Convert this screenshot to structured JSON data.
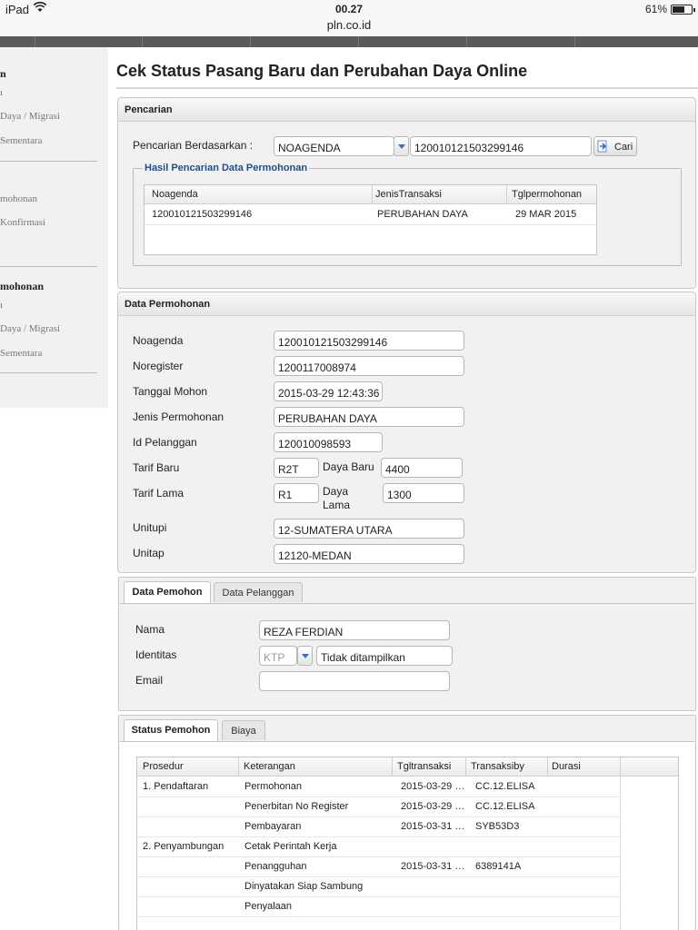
{
  "status_bar": {
    "device": "iPad",
    "time": "00.27",
    "url": "pln.co.id",
    "battery": "61%"
  },
  "sidebar": {
    "items": [
      {
        "text": "n",
        "bold": true
      },
      {
        "text": "ı",
        "bold": false
      },
      {
        "text": "Daya / Migrasi",
        "bold": false
      },
      {
        "text": "Sementara",
        "bold": false
      },
      {
        "text": "mohonan",
        "bold": false
      },
      {
        "text": "Konfirmasi",
        "bold": false
      },
      {
        "text": "mohonan",
        "bold": true
      },
      {
        "text": "ı",
        "bold": false
      },
      {
        "text": "Daya / Migrasi",
        "bold": false
      },
      {
        "text": "Sementara",
        "bold": false
      }
    ]
  },
  "page": {
    "title": "Cek Status Pasang Baru dan Perubahan Daya Online"
  },
  "pencarian": {
    "header": "Pencarian",
    "label": "Pencarian Berdasarkan :",
    "type_value": "NOAGENDA",
    "query_value": "120010121503299146",
    "button": "Cari",
    "legend": "Hasil Pencarian Data Permohonan",
    "columns": [
      "Noagenda",
      "JenisTransaksi",
      "Tglpermohonan"
    ],
    "rows": [
      [
        "120010121503299146",
        "PERUBAHAN DAYA",
        "29 MAR 2015"
      ]
    ]
  },
  "data_permohonan": {
    "header": "Data Permohonan",
    "noagenda": {
      "label": "Noagenda",
      "value": "120010121503299146"
    },
    "noregister": {
      "label": "Noregister",
      "value": "1200117008974"
    },
    "tanggal_mohon": {
      "label": "Tanggal Mohon",
      "value": "2015-03-29 12:43:36"
    },
    "jenis_permohonan": {
      "label": "Jenis Permohonan",
      "value": "PERUBAHAN DAYA"
    },
    "id_pelanggan": {
      "label": "Id Pelanggan",
      "value": "120010098593"
    },
    "tarif_baru": {
      "label": "Tarif Baru",
      "value": "R2T"
    },
    "daya_baru": {
      "label": "Daya Baru",
      "value": "4400"
    },
    "tarif_lama": {
      "label": "Tarif Lama",
      "value": "R1"
    },
    "daya_lama": {
      "label_line1": "Daya",
      "label_line2": "Lama",
      "value": "1300"
    },
    "unitupi": {
      "label": "Unitupi",
      "value": "12-SUMATERA UTARA"
    },
    "unitap": {
      "label": "Unitap",
      "value": "12120-MEDAN"
    }
  },
  "pemohon": {
    "tabs": [
      "Data Pemohon",
      "Data Pelanggan"
    ],
    "nama": {
      "label": "Nama",
      "value": "REZA FERDIAN"
    },
    "identitas": {
      "label": "Identitas",
      "type": "KTP",
      "value": "Tidak ditampilkan"
    },
    "email": {
      "label": "Email",
      "value": ""
    }
  },
  "status": {
    "tabs": [
      "Status Pemohon",
      "Biaya"
    ],
    "columns": [
      "Prosedur",
      "Keterangan",
      "Tgltransaksi",
      "Transaksiby",
      "Durasi"
    ],
    "rows": [
      [
        "1. Pendaftaran",
        "Permohonan",
        "2015-03-29 …",
        "CC.12.ELISA",
        ""
      ],
      [
        "",
        "Penerbitan No Register",
        "2015-03-29 …",
        "CC.12.ELISA",
        ""
      ],
      [
        "",
        "Pembayaran",
        "2015-03-31 …",
        "SYB53D3",
        ""
      ],
      [
        "2. Penyambungan",
        "Cetak Perintah Kerja",
        "",
        "",
        ""
      ],
      [
        "",
        "Penangguhan",
        "2015-03-31 …",
        "6389141A",
        ""
      ],
      [
        "",
        "Dinyatakan Siap Sambung",
        "",
        "",
        ""
      ],
      [
        "",
        "Penyalaan",
        "",
        "",
        ""
      ]
    ]
  }
}
